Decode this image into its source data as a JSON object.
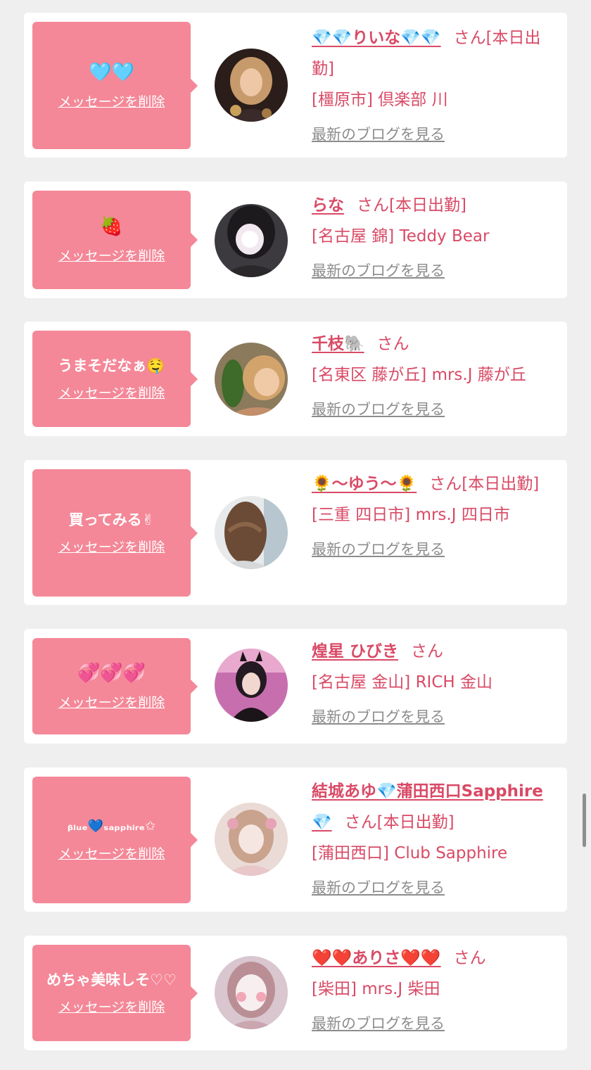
{
  "colors": {
    "accent": "#f48898",
    "name_text": "#d94a66",
    "link_gray": "#8c8c8c",
    "background": "#efefef"
  },
  "common": {
    "delete_label": "メッセージを削除",
    "blog_label": "最新のブログを見る",
    "san": "さん"
  },
  "cards": [
    {
      "message": "🩵🩵",
      "name": "💎💎りいな💎💎",
      "status": "[本日出勤]",
      "shop": "[橿原市] 倶楽部 川"
    },
    {
      "message": "🍓",
      "name": "らな",
      "status": "[本日出勤]",
      "shop": "[名古屋 錦] Teddy Bear"
    },
    {
      "message": "うまそだなぁ🤤",
      "name": "千枝🐘",
      "status": "",
      "shop": "[名東区 藤が丘] mrs.J 藤が丘"
    },
    {
      "message": "買ってみる✌",
      "name": "🌻〜ゆう〜🌻",
      "status": "[本日出勤]",
      "shop": "[三重 四日市] mrs.J 四日市"
    },
    {
      "message": "💞💞💞",
      "name": "煌星 ひびき",
      "status": "",
      "shop": "[名古屋 金山] RICH 金山"
    },
    {
      "message": "ᵦₗᵤₑ💙ₛₐₚₚₕᵢᵣₑ✩",
      "name": "結城あゆ💎蒲田西口Sapphire💎",
      "status": "[本日出勤]",
      "shop": "[蒲田西口] Club Sapphire"
    },
    {
      "message": "めちゃ美味しそ♡♡",
      "name": "❤️❤️ありさ❤️❤️",
      "status": "",
      "shop": "[柴田] mrs.J 柴田"
    }
  ]
}
